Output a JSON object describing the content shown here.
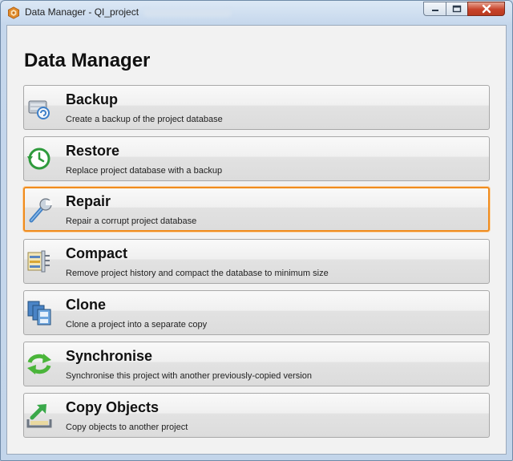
{
  "window": {
    "title": "Data Manager - QI_project",
    "controls": {
      "minimize": "minimize",
      "maximize": "maximize",
      "close": "close"
    }
  },
  "heading": "Data Manager",
  "actions": [
    {
      "label": "Backup",
      "desc": "Create a backup of the project database",
      "icon": "backup-icon",
      "selected": false
    },
    {
      "label": "Restore",
      "desc": "Replace project database with a backup",
      "icon": "restore-icon",
      "selected": false
    },
    {
      "label": "Repair",
      "desc": "Repair a corrupt project database",
      "icon": "repair-icon",
      "selected": true
    },
    {
      "label": "Compact",
      "desc": "Remove project history and compact the database to minimum size",
      "icon": "compact-icon",
      "selected": false
    },
    {
      "label": "Clone",
      "desc": "Clone a project into a separate copy",
      "icon": "clone-icon",
      "selected": false
    },
    {
      "label": "Synchronise",
      "desc": "Synchronise this project with another previously-copied version",
      "icon": "synchronise-icon",
      "selected": false
    },
    {
      "label": "Copy Objects",
      "desc": "Copy objects to another project",
      "icon": "copy-objects-icon",
      "selected": false
    }
  ],
  "colors": {
    "selection_border": "#f08c1e",
    "restore_green": "#2e9a3c",
    "sync_green": "#4ab53a"
  }
}
